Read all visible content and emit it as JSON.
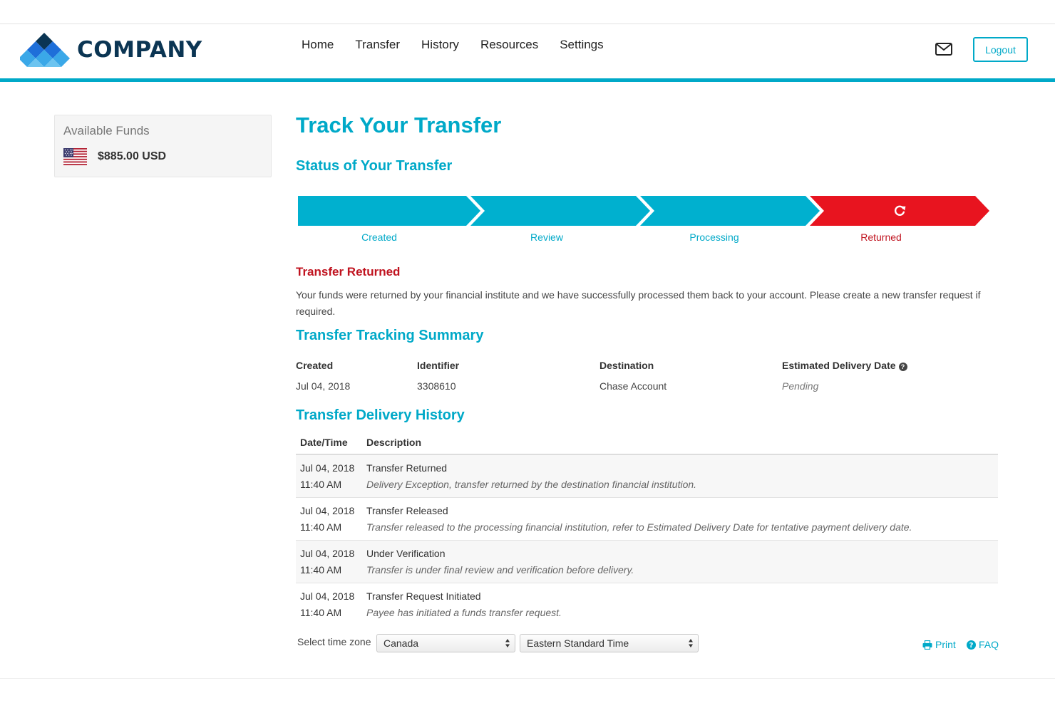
{
  "brand": {
    "name": "COMPANY",
    "accent": "#00a9c8",
    "dark": "#0b3553",
    "error": "#c0131f"
  },
  "nav": {
    "items": [
      "Home",
      "Transfer",
      "History",
      "Resources",
      "Settings"
    ]
  },
  "header": {
    "logout_label": "Logout",
    "mail_icon": "mail-icon"
  },
  "funds": {
    "label": "Available Funds",
    "amount": "$885.00 USD",
    "flag_icon": "us-flag-icon"
  },
  "page": {
    "title": "Track Your Transfer",
    "status_title": "Status of Your Transfer"
  },
  "stepper": {
    "steps": [
      {
        "label": "Created",
        "state": "complete"
      },
      {
        "label": "Review",
        "state": "complete"
      },
      {
        "label": "Processing",
        "state": "complete"
      },
      {
        "label": "Returned",
        "state": "returned",
        "icon": "refresh-icon"
      }
    ]
  },
  "returned": {
    "title": "Transfer Returned",
    "description": "Your funds were returned by your financial institute and we have successfully processed them back to your account. Please create a new transfer request if required."
  },
  "summary": {
    "title": "Transfer Tracking Summary",
    "headers": {
      "created": "Created",
      "identifier": "Identifier",
      "destination": "Destination",
      "eta": "Estimated Delivery Date"
    },
    "values": {
      "created": "Jul 04, 2018",
      "identifier": "3308610",
      "destination": "Chase Account",
      "eta": "Pending"
    }
  },
  "history": {
    "title": "Transfer Delivery History",
    "headers": {
      "datetime": "Date/Time",
      "description": "Description"
    },
    "rows": [
      {
        "date": "Jul 04, 2018",
        "time": "11:40 AM",
        "event": "Transfer Returned",
        "detail": "Delivery Exception, transfer returned by the destination financial institution."
      },
      {
        "date": "Jul 04, 2018",
        "time": "11:40 AM",
        "event": "Transfer Released",
        "detail": "Transfer released to the processing financial institution, refer to Estimated Delivery Date for tentative payment delivery date."
      },
      {
        "date": "Jul 04, 2018",
        "time": "11:40 AM",
        "event": "Under Verification",
        "detail": "Transfer is under final review and verification before delivery."
      },
      {
        "date": "Jul 04, 2018",
        "time": "11:40 AM",
        "event": "Transfer Request Initiated",
        "detail": "Payee has initiated a funds transfer request."
      }
    ]
  },
  "timezone": {
    "label": "Select time zone",
    "country": "Canada",
    "zone": "Eastern Standard Time"
  },
  "footer": {
    "print_label": "Print",
    "faq_label": "FAQ"
  }
}
